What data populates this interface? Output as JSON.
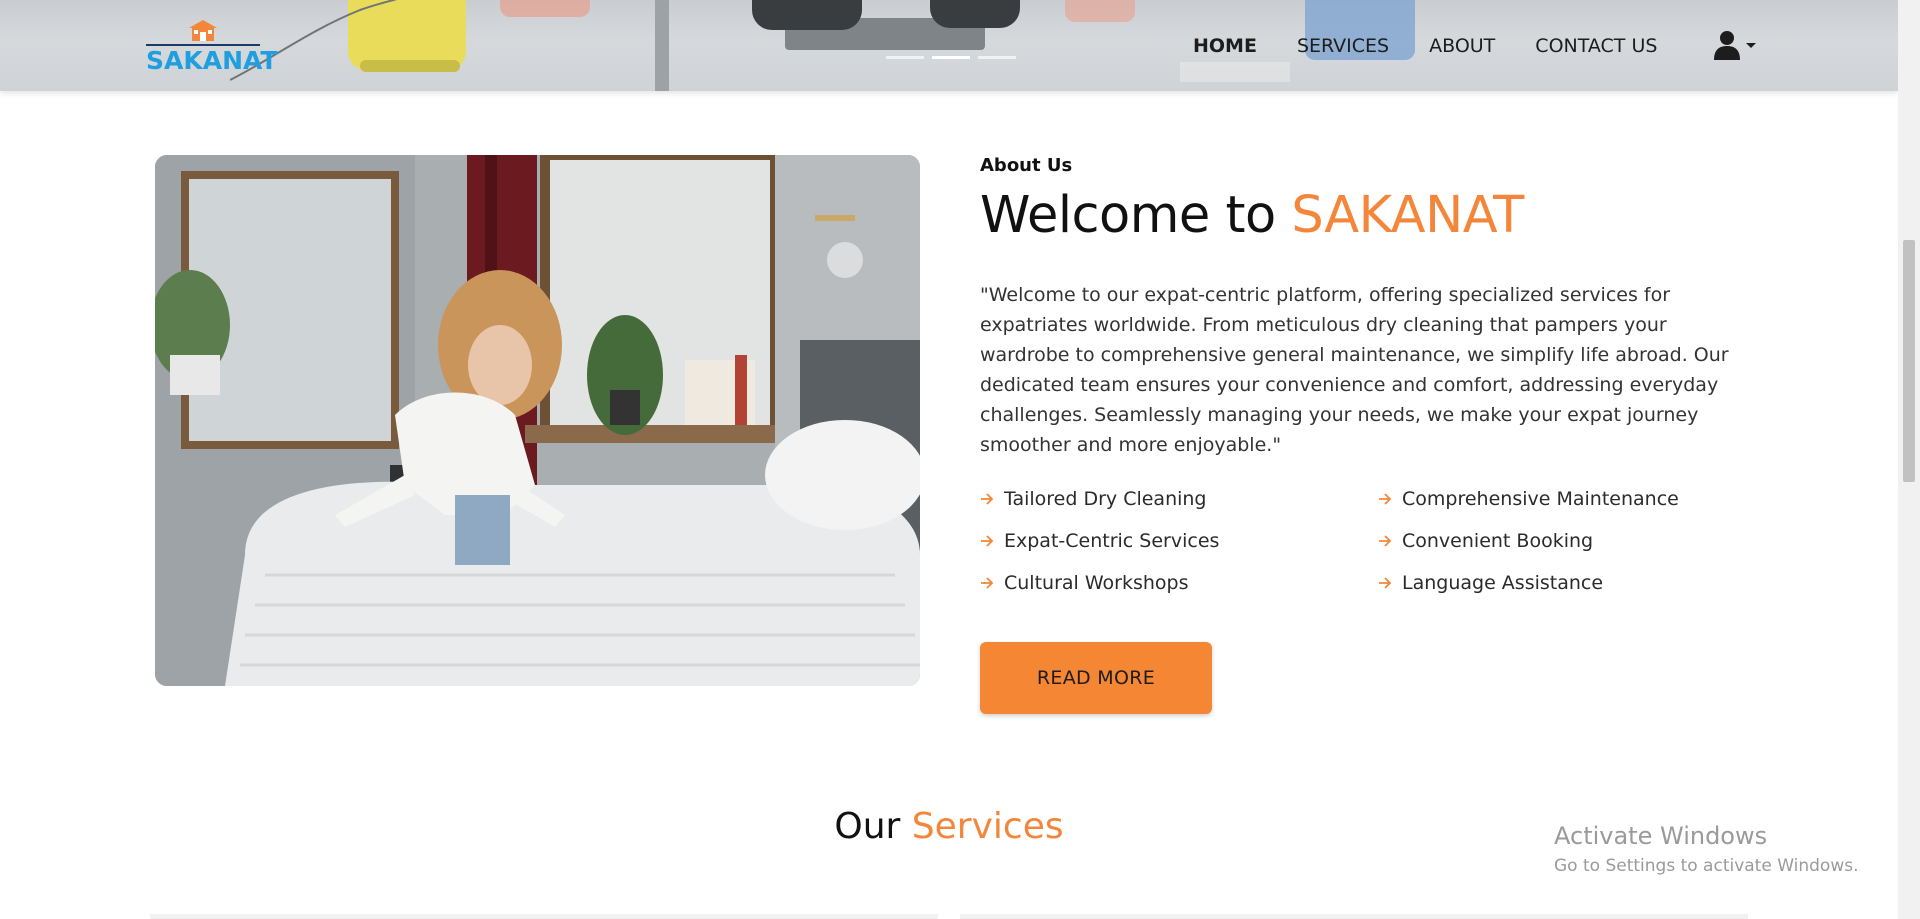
{
  "brand": {
    "name": "SAKANAT",
    "logo_color": "#1f9fe0",
    "accent_color": "#f4863b"
  },
  "nav": {
    "items": [
      {
        "label": "HOME",
        "active": true
      },
      {
        "label": "SERVICES",
        "active": false
      },
      {
        "label": "ABOUT",
        "active": false
      },
      {
        "label": "CONTACT US",
        "active": false
      }
    ],
    "user_icon": "user-icon",
    "dropdown_icon": "caret-down-icon"
  },
  "hero_slider": {
    "slides": 3,
    "active_index": 1
  },
  "about": {
    "eyebrow": "About Us",
    "title_prefix": "Welcome to ",
    "title_highlight": "SAKANAT",
    "intro": "\"Welcome to our expat-centric platform, offering specialized services for expatriates worldwide. From meticulous dry cleaning that pampers your wardrobe to comprehensive general maintenance, we simplify life abroad. Our dedicated team ensures your convenience and comfort, addressing everyday challenges. Seamlessly managing your needs, we make your expat journey smoother and more enjoyable.\"",
    "features": [
      "Tailored Dry Cleaning",
      "Comprehensive Maintenance",
      "Expat-Centric Services",
      "Convenient Booking",
      "Cultural Workshops",
      "Language Assistance"
    ],
    "feature_icon": "arrow-right-icon",
    "read_more_label": "READ MORE"
  },
  "services": {
    "title_prefix": "Our ",
    "title_highlight": "Services"
  },
  "watermark": {
    "title": "Activate Windows",
    "subtitle": "Go to Settings to activate Windows."
  }
}
